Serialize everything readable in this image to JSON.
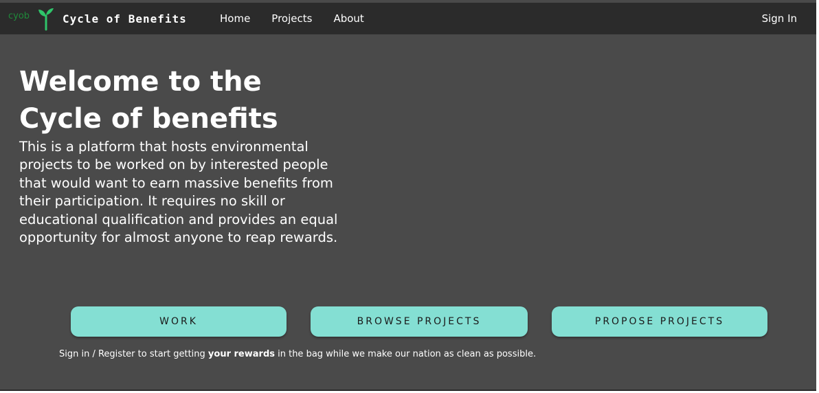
{
  "header": {
    "logo_text": "cyob",
    "brand_name": "Cycle of Benefits",
    "nav": [
      {
        "label": "Home"
      },
      {
        "label": "Projects"
      },
      {
        "label": "About"
      }
    ],
    "sign_in": "Sign In"
  },
  "hero": {
    "title": "Welcome to the Cycle of benefits",
    "description": "This is a platform that hosts environmental projects to be worked on by interested people that would want to earn massive benefits from their participation. It requires no skill or educational qualification and provides an equal opportunity for almost anyone to reap rewards."
  },
  "actions": {
    "work": "WORK",
    "browse": "BROWSE PROJECTS",
    "propose": "PROPOSE PROJECTS"
  },
  "footnote": {
    "before": "Sign in / Register to start getting ",
    "bold": "your rewards",
    "after": " in the bag while we make our nation as clean as possible."
  },
  "colors": {
    "page_bg": "#4a4a4a",
    "header_bg": "#2b2b2b",
    "button_bg": "#84dfd3",
    "logo_green": "#1f8a3a",
    "sprout_green": "#2fc46a"
  },
  "icons": {
    "logo": "sprout-icon"
  }
}
